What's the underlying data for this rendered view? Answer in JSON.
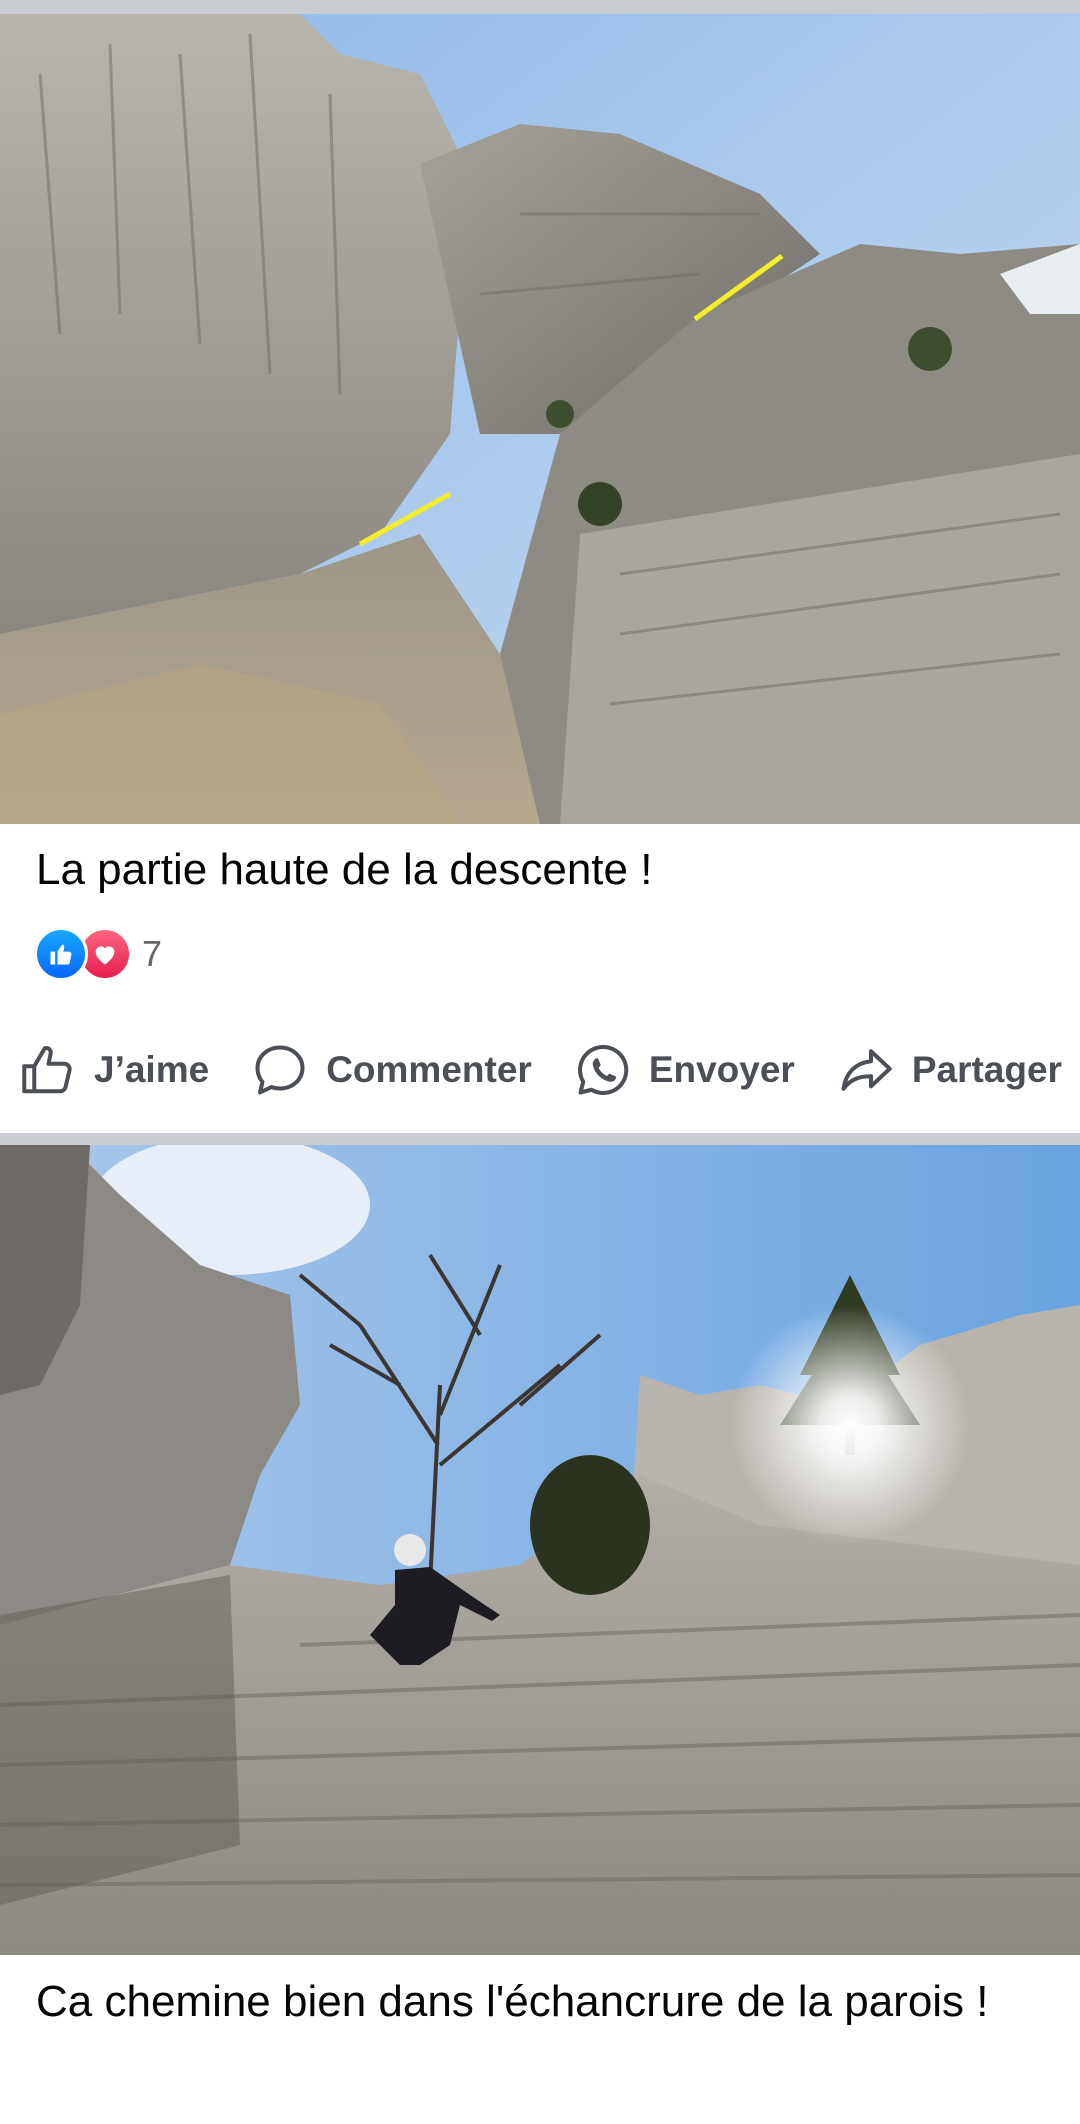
{
  "posts": [
    {
      "caption": "La partie haute de la descente !",
      "reaction_count": "7",
      "reactions": [
        "like-icon",
        "love-icon"
      ]
    },
    {
      "caption": "Ca chemine bien dans l'échancrure de la parois !"
    }
  ],
  "actions": {
    "like_label": "J’aime",
    "comment_label": "Commenter",
    "send_label": "Envoyer",
    "share_label": "Partager"
  },
  "colors": {
    "like_blue": "#0866ff",
    "love_red": "#e61e4d",
    "divider": "#c9ccd1",
    "action_text": "#4b4f56"
  }
}
